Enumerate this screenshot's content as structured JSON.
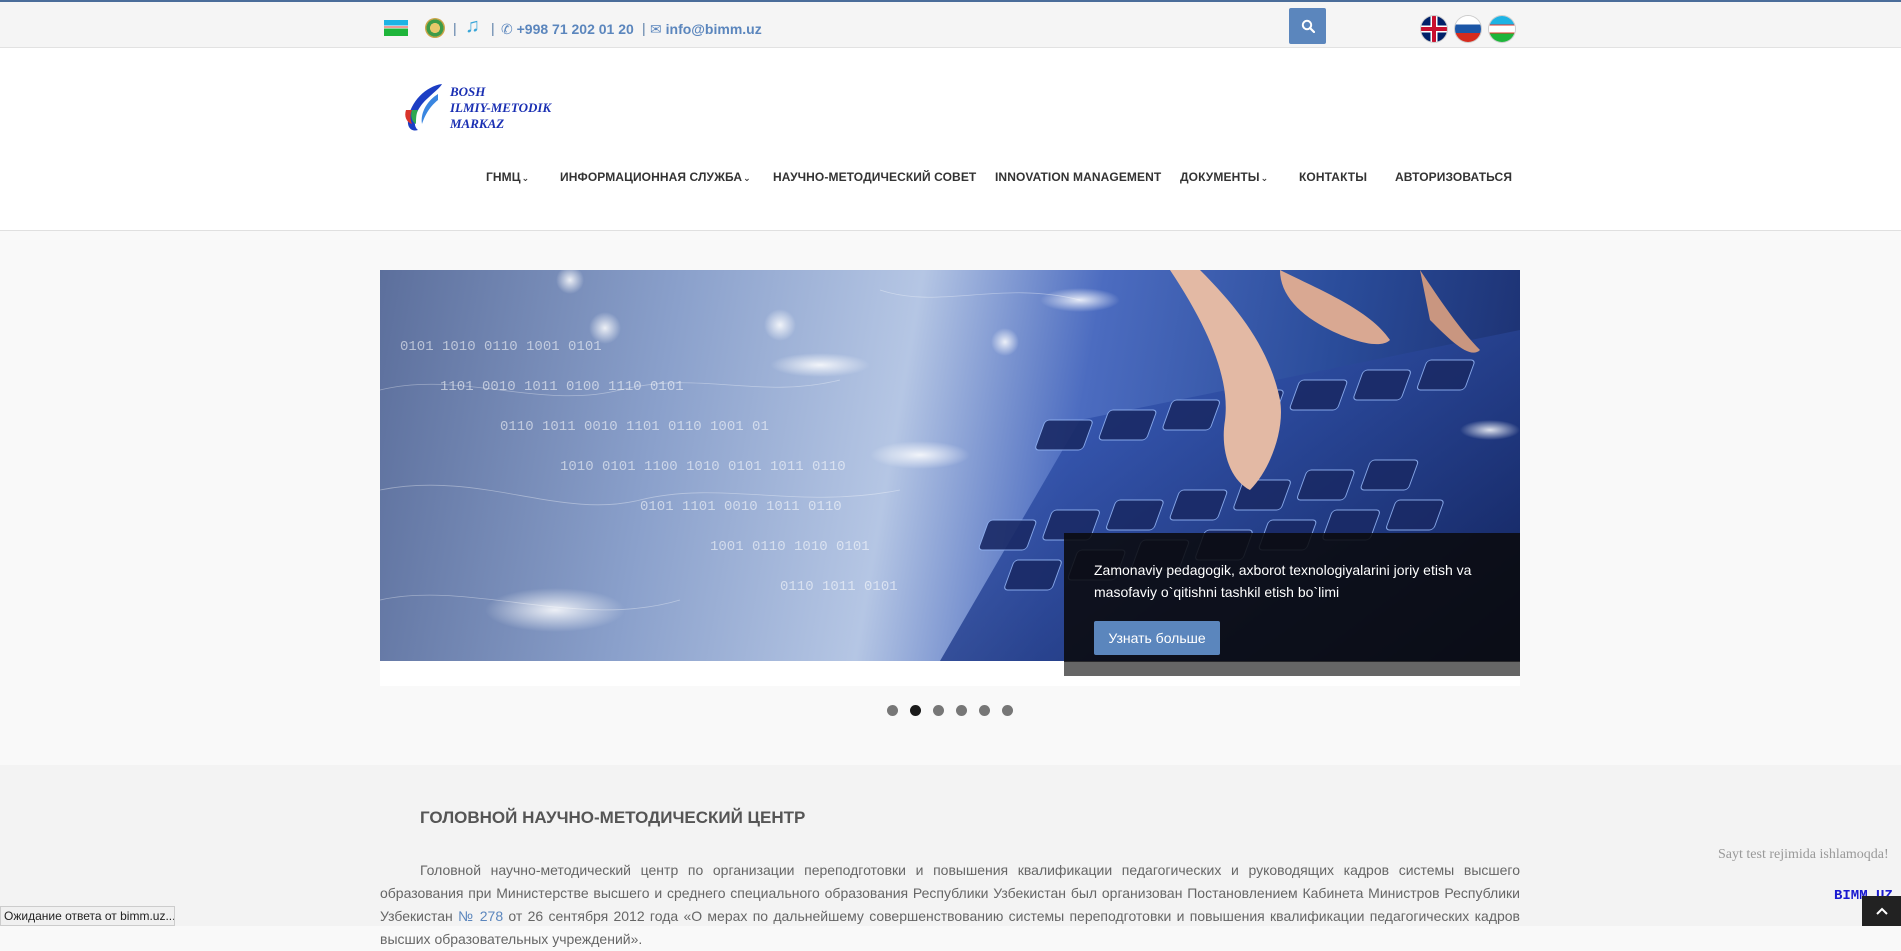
{
  "topbar": {
    "phone": "+998 71 202 01 20",
    "email": "info@bimm.uz",
    "separator": "|",
    "icons": [
      "uz-flag-icon",
      "state-emblem-icon",
      "music-note-icon",
      "phone-icon",
      "envelope-icon",
      "search-icon"
    ],
    "languages": [
      "en",
      "ru",
      "uz"
    ]
  },
  "header": {
    "logo_lines": [
      "BOSH",
      "ILMIY-METODIK",
      "MARKAZ"
    ],
    "nav": [
      {
        "label": "ГНМЦ",
        "has_dropdown": true
      },
      {
        "label": "ИНФОРМАЦИОННАЯ СЛУЖБА",
        "has_dropdown": true
      },
      {
        "label": "НАУЧНО-МЕТОДИЧЕСКИЙ СОВЕТ",
        "has_dropdown": false
      },
      {
        "label": "INNOVATION MANAGEMENT",
        "has_dropdown": false
      },
      {
        "label": "ДОКУМЕНТЫ",
        "has_dropdown": true
      },
      {
        "label": "КОНТАКТЫ",
        "has_dropdown": false
      },
      {
        "label": "АВТОРИЗОВАТЬСЯ",
        "has_dropdown": false
      }
    ]
  },
  "slider": {
    "caption": "Zamonaviy pedagogik, axborot texnologiyalarini joriy etish va masofaviy o`qitishni tashkil etish bo`limi",
    "button_label": "Узнать больше",
    "slide_count": 6,
    "active_index": 1
  },
  "content": {
    "title": "ГОЛОВНОЙ НАУЧНО-МЕТОДИЧЕСКИЙ ЦЕНТР",
    "text_before_link": "Головной научно-методический центр по организации переподготовки и повышения квалификации педагогических и руководящих кадров системы высшего образования при Министерстве высшего и среднего специального образования Республики Узбекистан был организован Постановлением Кабинета Министров Республики Узбекистан ",
    "link_text": "№ 278",
    "text_after_link": " от 26 сентября 2012 года «О мерах по дальнейшему совершенствованию системы переподготовки и повышения квалификации педагогических кадров высших образовательных учреждений»."
  },
  "overlay": {
    "test_note": "Sayt test rejimida ishlamoqda!",
    "bimm_label": "BIMM.UZ",
    "to_top_icon": "chevron-up-icon"
  },
  "browser_status": "Ожидание ответа от bimm.uz..."
}
